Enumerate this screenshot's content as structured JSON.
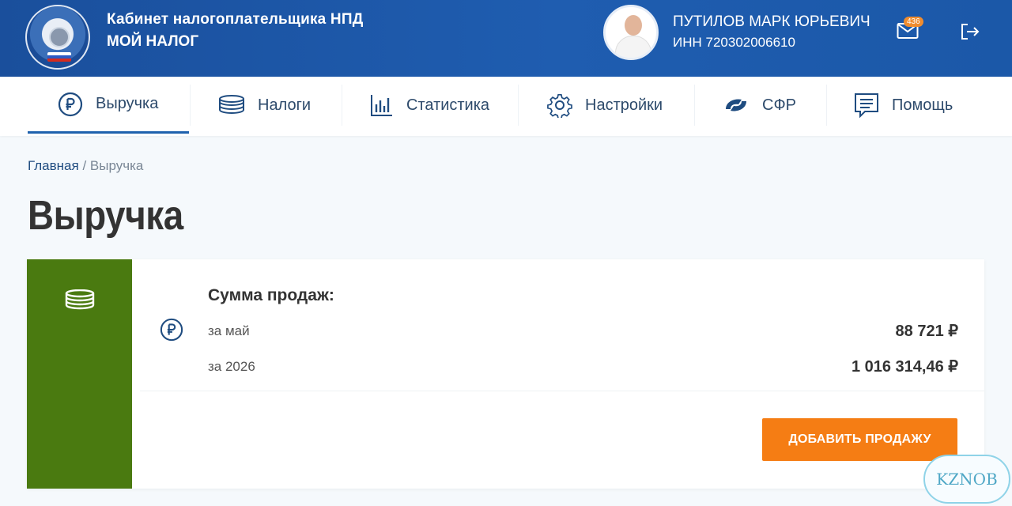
{
  "header": {
    "title_line1": "Кабинет налогоплательщика НПД",
    "title_line2": "МОЙ НАЛОГ",
    "user_name": "ПУТИЛОВ МАРК ЮРЬЕВИЧ",
    "user_inn": "ИНН 720302006610",
    "notification_count": "436"
  },
  "nav": {
    "items": [
      {
        "label": "Выручка",
        "icon": "ruble-icon",
        "active": true
      },
      {
        "label": "Налоги",
        "icon": "coins-icon"
      },
      {
        "label": "Статистика",
        "icon": "bar-chart-icon"
      },
      {
        "label": "Настройки",
        "icon": "gear-icon"
      },
      {
        "label": "СФР",
        "icon": "sfr-icon"
      },
      {
        "label": "Помощь",
        "icon": "help-chat-icon"
      }
    ]
  },
  "breadcrumb": {
    "home": "Главная",
    "separator": " / ",
    "current": "Выручка"
  },
  "page": {
    "title": "Выручка"
  },
  "sales": {
    "title": "Сумма продаж:",
    "rows": [
      {
        "label": "за май",
        "value": "88 721 ₽"
      },
      {
        "label": "за 2026",
        "value": "1 016 314,46 ₽"
      }
    ],
    "add_button": "ДОБАВИТЬ ПРОДАЖУ"
  },
  "watermark": "KZNOB",
  "colors": {
    "header": "#1f5db0",
    "accent": "#1f62ad",
    "card_side": "#4a7a10",
    "button": "#f57d14"
  }
}
